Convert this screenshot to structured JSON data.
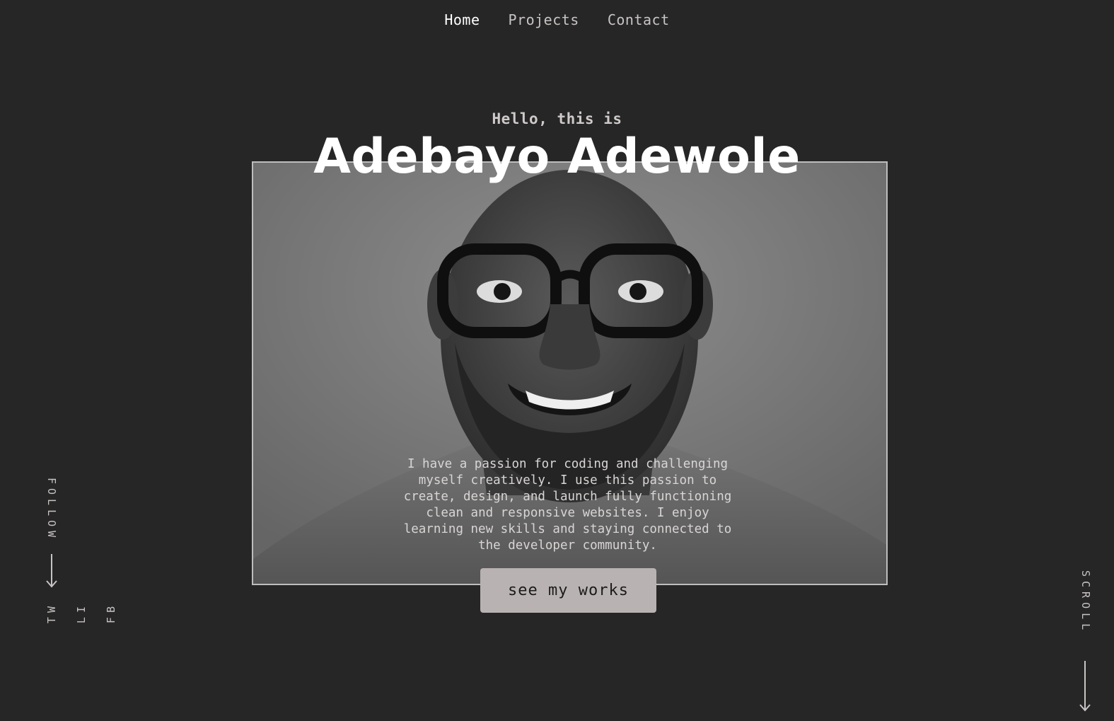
{
  "nav": {
    "items": [
      {
        "label": "Home",
        "active": true
      },
      {
        "label": "Projects",
        "active": false
      },
      {
        "label": "Contact",
        "active": false
      }
    ]
  },
  "hero": {
    "greeting": "Hello, this is",
    "name": "Adebayo Adewole",
    "bio": "I have a passion for coding and challenging myself creatively. I use this passion to create, design, and launch fully functioning clean and responsive websites. I enjoy learning new skills and staying connected to the developer community.",
    "cta_label": "see my works"
  },
  "side": {
    "follow_label": "FOLLOW",
    "socials": [
      "FB",
      "LI",
      "TW"
    ],
    "scroll_label": "SCROLL"
  },
  "colors": {
    "background": "#262626",
    "button": "#b9b2b2",
    "text": "#d6d1d1",
    "heading": "#ffffff"
  },
  "icons": {
    "follow_arrow": "arrow-down-icon",
    "scroll_arrow": "arrow-down-icon"
  }
}
